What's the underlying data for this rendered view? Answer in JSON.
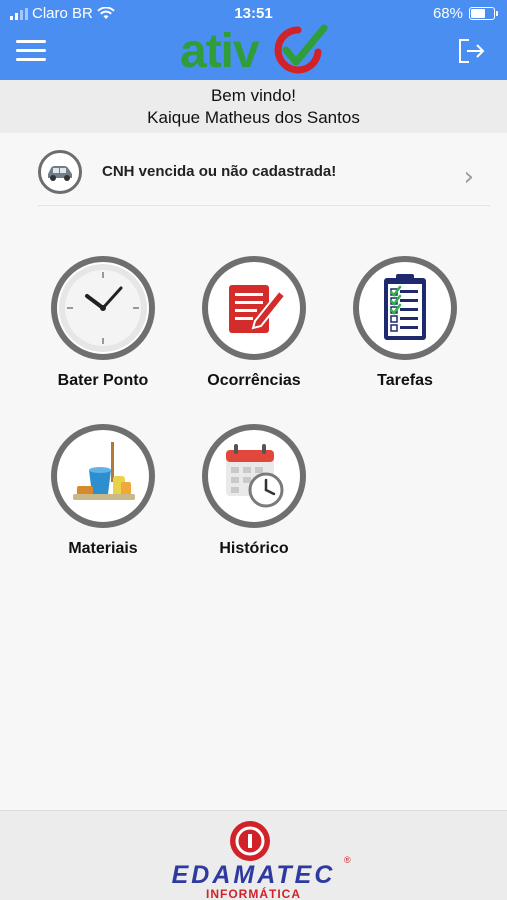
{
  "status_bar": {
    "carrier": "Claro BR",
    "time": "13:51",
    "battery": "68%",
    "battery_level": 0.68
  },
  "header": {
    "logo_text": "ativ",
    "menu_icon": "hamburger-menu-icon",
    "logout_icon": "logout-icon"
  },
  "welcome": {
    "greeting": "Bem vindo!",
    "user_name": "Kaique Matheus dos Santos"
  },
  "cnh": {
    "message": "CNH vencida ou não cadastrada!",
    "icon": "car-icon",
    "chevron": "›"
  },
  "tiles": [
    {
      "label": "Bater Ponto",
      "icon": "clock-icon"
    },
    {
      "label": "Ocorrências",
      "icon": "report-edit-icon"
    },
    {
      "label": "Tarefas",
      "icon": "clipboard-checklist-icon"
    },
    {
      "label": "Materiais",
      "icon": "cleaning-supplies-icon"
    },
    {
      "label": "Histórico",
      "icon": "calendar-clock-icon"
    }
  ],
  "footer": {
    "brand": "EDAMATEC",
    "sub": "INFORMÁTICA",
    "registered": "®"
  },
  "colors": {
    "header_blue": "#4a8ef2",
    "logo_green": "#2f9e3a",
    "logo_red": "#d1222a",
    "ring_gray": "#6f6f6f",
    "brand_blue": "#2f3aa0"
  }
}
